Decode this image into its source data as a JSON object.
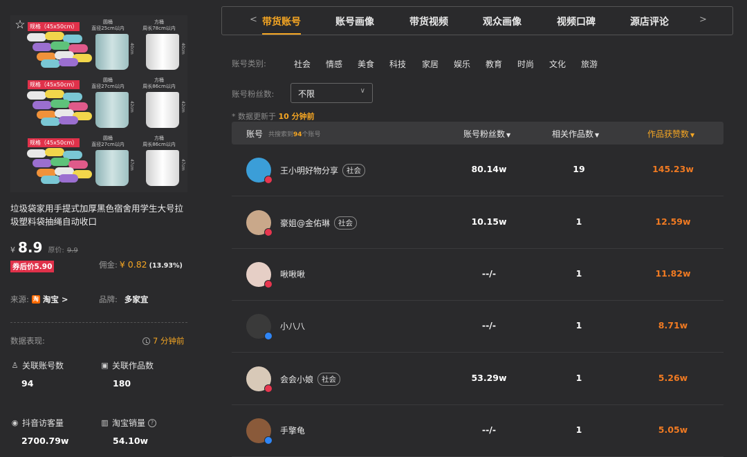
{
  "product": {
    "title": "垃圾袋家用手提式加厚黑色宿舍用学生大号拉圾塑料袋抽绳自动收口",
    "image": {
      "rows": [
        {
          "spec": "规格（45x50cm）",
          "round_label": "圆桶",
          "round_sub": "直径25cm以内",
          "round_h": "40cm",
          "square_label": "方桶",
          "square_sub": "周长78cm以内",
          "square_h": "40cm"
        },
        {
          "spec": "规格（45x50cm）",
          "round_label": "圆桶",
          "round_sub": "直径27cm以内",
          "round_h": "42cm",
          "square_label": "方桶",
          "square_sub": "周长86cm以内",
          "square_h": "42cm"
        },
        {
          "spec": "规格（45x50cm）",
          "round_label": "圆桶",
          "round_sub": "直径27cm以内",
          "round_h": "47cm",
          "square_label": "方桶",
          "square_sub": "周长86cm以内",
          "square_h": "47cm"
        }
      ],
      "roll_colors": [
        "#e8e8e8",
        "#f2d64b",
        "#7ac7d4",
        "#9b6fd0",
        "#5ec27a",
        "#e05a8a",
        "#f0923a"
      ]
    },
    "currency": "¥",
    "price": "8.9",
    "orig_label": "原价:",
    "orig_price": "9.9",
    "coupon_text": "券后价5.90",
    "commission_label": "佣金:",
    "commission": "¥ 0.82",
    "commission_pct": "(13.93%)",
    "source_label": "来源:",
    "source_icon": "淘",
    "source_value": "淘宝 >",
    "brand_label": "品牌:",
    "brand_value": "多家宜",
    "perf_label": "数据表现:",
    "perf_time": "7 分钟前",
    "stats": {
      "accounts_label": "关联账号数",
      "accounts_value": "94",
      "works_label": "关联作品数",
      "works_value": "180",
      "visits_label": "抖音访客量",
      "visits_value": "2700.79w",
      "sales_label": "淘宝销量",
      "sales_value": "54.10w",
      "help_glyph": "?"
    }
  },
  "tabs": {
    "prev": "<",
    "next": ">",
    "items": [
      "带货账号",
      "账号画像",
      "带货视频",
      "观众画像",
      "视频口碑",
      "源店评论"
    ],
    "active_index": 0
  },
  "filters": {
    "category_label": "账号类别:",
    "categories": [
      "社会",
      "情感",
      "美食",
      "科技",
      "家居",
      "娱乐",
      "教育",
      "时尚",
      "文化",
      "旅游"
    ],
    "fans_label": "账号粉丝数:",
    "fans_value": "不限",
    "update_prefix": "* 数据更新于",
    "update_time": "10 分钟前"
  },
  "table": {
    "col_account": "账号",
    "search_prefix": "共搜索到",
    "search_count": "94",
    "search_suffix": "个账号",
    "col_fans": "账号粉丝数",
    "col_works": "相关作品数",
    "col_likes": "作品获赞数",
    "sort_glyph": "▼",
    "rows": [
      {
        "name": "王小明好物分享",
        "tag": "社会",
        "fans": "80.14w",
        "works": "19",
        "likes": "145.23w",
        "avatar_color": "#3b9ed8",
        "badge": "red"
      },
      {
        "name": "豪姐@金佑琳",
        "tag": "社会",
        "fans": "10.15w",
        "works": "1",
        "likes": "12.59w",
        "avatar_color": "#c9a88a",
        "badge": "red"
      },
      {
        "name": "啾啾啾",
        "tag": "",
        "fans": "--/-",
        "works": "1",
        "likes": "11.82w",
        "avatar_color": "#e6cfc6",
        "badge": "red"
      },
      {
        "name": "小八八",
        "tag": "",
        "fans": "--/-",
        "works": "1",
        "likes": "8.71w",
        "avatar_color": "#3a3a3a",
        "badge": "blue"
      },
      {
        "name": "会会小娘",
        "tag": "社会",
        "fans": "53.29w",
        "works": "1",
        "likes": "5.26w",
        "avatar_color": "#d8c9b8",
        "badge": "red"
      },
      {
        "name": "手擎龟",
        "tag": "",
        "fans": "--/-",
        "works": "1",
        "likes": "5.05w",
        "avatar_color": "#8a5a3a",
        "badge": "blue"
      }
    ]
  }
}
